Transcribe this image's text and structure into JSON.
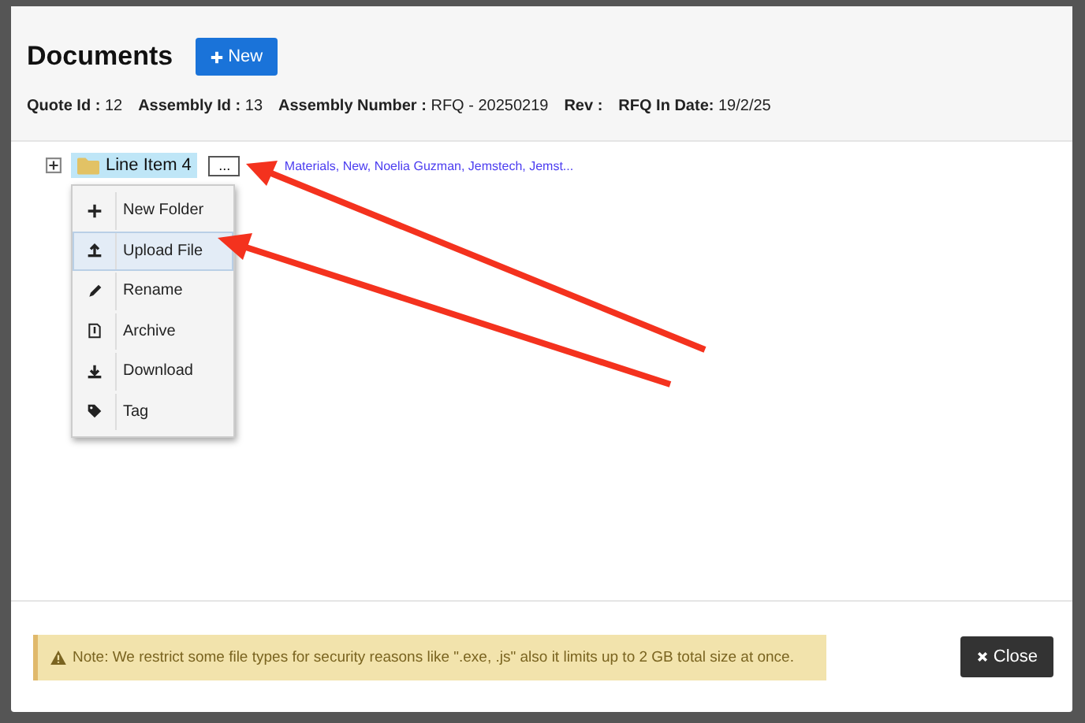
{
  "dialog": {
    "title": "Documents",
    "new_button": "New",
    "meta": [
      {
        "label": "Quote Id :",
        "value": "12"
      },
      {
        "label": "Assembly Id :",
        "value": "13"
      },
      {
        "label": "Assembly Number :",
        "value": "RFQ - 20250219"
      },
      {
        "label": "Rev :"
      },
      {
        "label": "RFQ In Date:",
        "value": "19/2/25"
      }
    ],
    "tree": {
      "label": "Line Item 4",
      "expanded": false,
      "selected": true,
      "more_button": "...",
      "details": "Materials, New, Noelia Guzman, Jemstech, Jemst..."
    },
    "menu": [
      {
        "label": "New Folder",
        "selected": false
      },
      {
        "label": "Upload File",
        "selected": true
      },
      {
        "label": "Rename",
        "selected": false
      },
      {
        "label": "Archive",
        "selected": false
      },
      {
        "label": "Download",
        "selected": false
      },
      {
        "label": "Tag",
        "selected": false
      }
    ],
    "note": "Note: We restrict some file types for security reasons like \".exe, .js\" also it limits up to 2 GB total size at once.",
    "close_button": "Close"
  }
}
